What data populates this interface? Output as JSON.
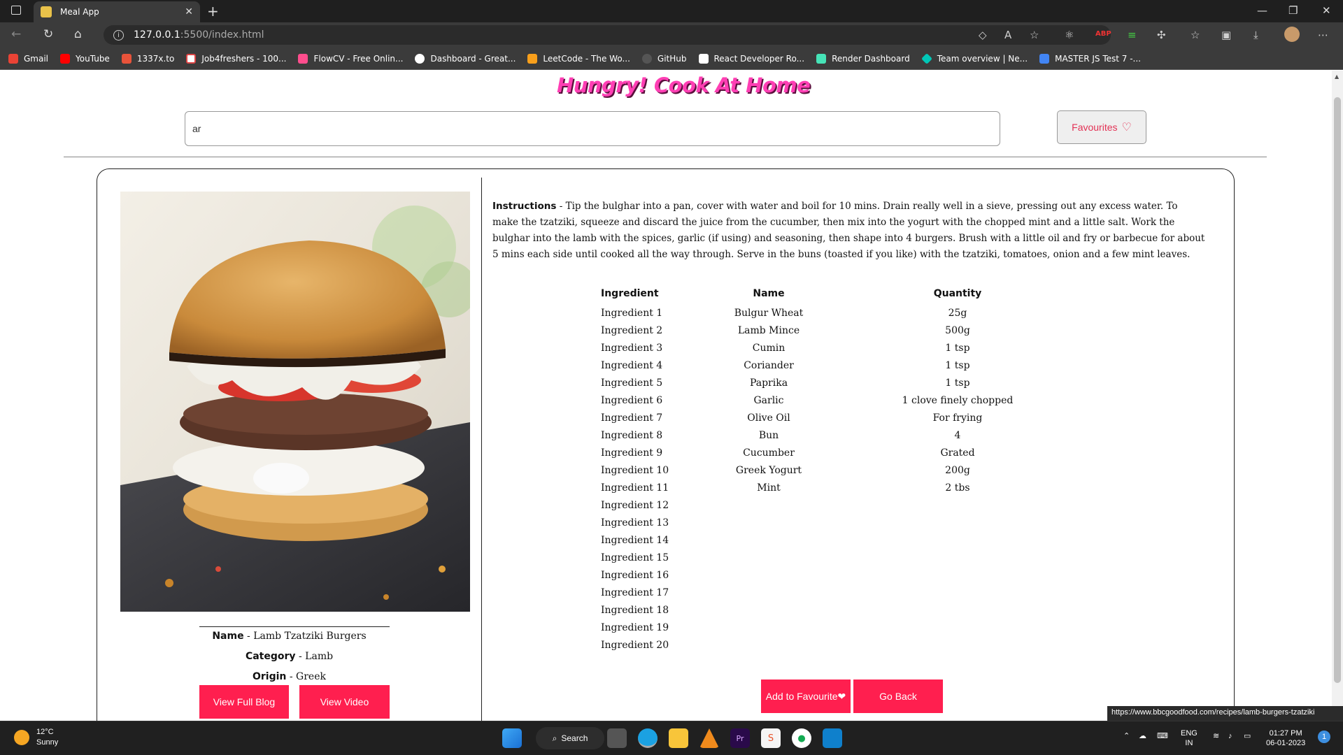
{
  "browser": {
    "tab_title": "Meal App",
    "url_host": "127.0.0.1",
    "url_path": ":5500/index.html",
    "bookmarks": [
      {
        "label": "Gmail",
        "color": "#ea4335"
      },
      {
        "label": "YouTube",
        "color": "#ff0000"
      },
      {
        "label": "1337x.to",
        "color": "#e8533a"
      },
      {
        "label": "Job4freshers - 100...",
        "color": "#d44"
      },
      {
        "label": "FlowCV - Free Onlin...",
        "color": "#ff4d8d"
      },
      {
        "label": "Dashboard - Great...",
        "color": "#ffffff"
      },
      {
        "label": "LeetCode - The Wo...",
        "color": "#f89f1b"
      },
      {
        "label": "GitHub",
        "color": "#222222"
      },
      {
        "label": "React Developer Ro...",
        "color": "#111111"
      },
      {
        "label": "Render Dashboard",
        "color": "#46e3b7"
      },
      {
        "label": "Team overview | Ne...",
        "color": "#00c7b7"
      },
      {
        "label": "MASTER JS Test 7 -...",
        "color": "#4285f4"
      }
    ]
  },
  "app": {
    "brand": "Hungry! Cook At Home",
    "search_value": "ar",
    "favourites_label": "Favourites",
    "heart_glyph": "♡"
  },
  "meal": {
    "name_label": "Name",
    "name": "Lamb Tzatziki Burgers",
    "category_label": "Category",
    "category": "Lamb",
    "origin_label": "Origin",
    "origin": "Greek",
    "blog_button": "View Full Blog",
    "video_button": "View Video",
    "instructions_label": "Instructions",
    "instructions": "Tip the bulghar into a pan, cover with water and boil for 10 mins. Drain really well in a sieve, pressing out any excess water. To make the tzatziki, squeeze and discard the juice from the cucumber, then mix into the yogurt with the chopped mint and a little salt. Work the bulghar into the lamb with the spices, garlic (if using) and seasoning, then shape into 4 burgers. Brush with a little oil and fry or barbecue for about 5 mins each side until cooked all the way through. Serve in the buns (toasted if you like) with the tzatziki, tomatoes, onion and a few mint leaves.",
    "table_headers": {
      "ingredient": "Ingredient",
      "name": "Name",
      "quantity": "Quantity"
    },
    "ingredients": [
      "Ingredient 1",
      "Ingredient 2",
      "Ingredient 3",
      "Ingredient 4",
      "Ingredient 5",
      "Ingredient 6",
      "Ingredient 7",
      "Ingredient 8",
      "Ingredient 9",
      "Ingredient 10",
      "Ingredient 11",
      "Ingredient 12",
      "Ingredient 13",
      "Ingredient 14",
      "Ingredient 15",
      "Ingredient 16",
      "Ingredient 17",
      "Ingredient 18",
      "Ingredient 19",
      "Ingredient 20"
    ],
    "names": [
      "Bulgur Wheat",
      "Lamb Mince",
      "Cumin",
      "Coriander",
      "Paprika",
      "Garlic",
      "Olive Oil",
      "Bun",
      "Cucumber",
      "Greek Yogurt",
      "Mint"
    ],
    "quantities": [
      "25g",
      "500g",
      "1 tsp",
      "1 tsp",
      "1 tsp",
      "1 clove finely chopped",
      "For frying",
      "4",
      "Grated",
      "200g",
      "2 tbs"
    ],
    "add_fav_button": "Add to Favourite",
    "add_fav_heart": "❤",
    "back_button": "Go Back"
  },
  "status_tooltip": "https://www.bbcgoodfood.com/recipes/lamb-burgers-tzatziki",
  "taskbar": {
    "temp": "12°C",
    "weather": "Sunny",
    "search_label": "Search",
    "lang_top": "ENG",
    "lang_bottom": "IN",
    "time": "01:27 PM",
    "date": "06-01-2023",
    "notif_count": "1"
  },
  "colors": {
    "accent_pink": "#ff1f4f",
    "brand_pink": "#ff3fb4"
  }
}
